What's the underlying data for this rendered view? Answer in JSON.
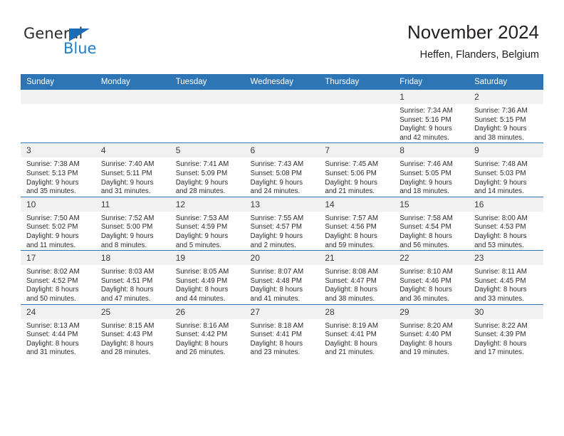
{
  "logo": {
    "word1": "General",
    "word2": "Blue",
    "triangle_color": "#1b6cb3",
    "blue_color": "#1b7fd1"
  },
  "header": {
    "title": "November 2024",
    "subtitle": "Heffen, Flanders, Belgium"
  },
  "theme": {
    "header_blue": "#2e75b6",
    "daynum_bg": "#f1f1f1",
    "text": "#2b2b2b"
  },
  "weekdays": [
    "Sunday",
    "Monday",
    "Tuesday",
    "Wednesday",
    "Thursday",
    "Friday",
    "Saturday"
  ],
  "weeks": [
    [
      {
        "day": "",
        "blank": true
      },
      {
        "day": "",
        "blank": true
      },
      {
        "day": "",
        "blank": true
      },
      {
        "day": "",
        "blank": true
      },
      {
        "day": "",
        "blank": true
      },
      {
        "day": "1",
        "sunrise": "Sunrise: 7:34 AM",
        "sunset": "Sunset: 5:16 PM",
        "daylight1": "Daylight: 9 hours",
        "daylight2": "and 42 minutes."
      },
      {
        "day": "2",
        "sunrise": "Sunrise: 7:36 AM",
        "sunset": "Sunset: 5:15 PM",
        "daylight1": "Daylight: 9 hours",
        "daylight2": "and 38 minutes."
      }
    ],
    [
      {
        "day": "3",
        "sunrise": "Sunrise: 7:38 AM",
        "sunset": "Sunset: 5:13 PM",
        "daylight1": "Daylight: 9 hours",
        "daylight2": "and 35 minutes."
      },
      {
        "day": "4",
        "sunrise": "Sunrise: 7:40 AM",
        "sunset": "Sunset: 5:11 PM",
        "daylight1": "Daylight: 9 hours",
        "daylight2": "and 31 minutes."
      },
      {
        "day": "5",
        "sunrise": "Sunrise: 7:41 AM",
        "sunset": "Sunset: 5:09 PM",
        "daylight1": "Daylight: 9 hours",
        "daylight2": "and 28 minutes."
      },
      {
        "day": "6",
        "sunrise": "Sunrise: 7:43 AM",
        "sunset": "Sunset: 5:08 PM",
        "daylight1": "Daylight: 9 hours",
        "daylight2": "and 24 minutes."
      },
      {
        "day": "7",
        "sunrise": "Sunrise: 7:45 AM",
        "sunset": "Sunset: 5:06 PM",
        "daylight1": "Daylight: 9 hours",
        "daylight2": "and 21 minutes."
      },
      {
        "day": "8",
        "sunrise": "Sunrise: 7:46 AM",
        "sunset": "Sunset: 5:05 PM",
        "daylight1": "Daylight: 9 hours",
        "daylight2": "and 18 minutes."
      },
      {
        "day": "9",
        "sunrise": "Sunrise: 7:48 AM",
        "sunset": "Sunset: 5:03 PM",
        "daylight1": "Daylight: 9 hours",
        "daylight2": "and 14 minutes."
      }
    ],
    [
      {
        "day": "10",
        "sunrise": "Sunrise: 7:50 AM",
        "sunset": "Sunset: 5:02 PM",
        "daylight1": "Daylight: 9 hours",
        "daylight2": "and 11 minutes."
      },
      {
        "day": "11",
        "sunrise": "Sunrise: 7:52 AM",
        "sunset": "Sunset: 5:00 PM",
        "daylight1": "Daylight: 9 hours",
        "daylight2": "and 8 minutes."
      },
      {
        "day": "12",
        "sunrise": "Sunrise: 7:53 AM",
        "sunset": "Sunset: 4:59 PM",
        "daylight1": "Daylight: 9 hours",
        "daylight2": "and 5 minutes."
      },
      {
        "day": "13",
        "sunrise": "Sunrise: 7:55 AM",
        "sunset": "Sunset: 4:57 PM",
        "daylight1": "Daylight: 9 hours",
        "daylight2": "and 2 minutes."
      },
      {
        "day": "14",
        "sunrise": "Sunrise: 7:57 AM",
        "sunset": "Sunset: 4:56 PM",
        "daylight1": "Daylight: 8 hours",
        "daylight2": "and 59 minutes."
      },
      {
        "day": "15",
        "sunrise": "Sunrise: 7:58 AM",
        "sunset": "Sunset: 4:54 PM",
        "daylight1": "Daylight: 8 hours",
        "daylight2": "and 56 minutes."
      },
      {
        "day": "16",
        "sunrise": "Sunrise: 8:00 AM",
        "sunset": "Sunset: 4:53 PM",
        "daylight1": "Daylight: 8 hours",
        "daylight2": "and 53 minutes."
      }
    ],
    [
      {
        "day": "17",
        "sunrise": "Sunrise: 8:02 AM",
        "sunset": "Sunset: 4:52 PM",
        "daylight1": "Daylight: 8 hours",
        "daylight2": "and 50 minutes."
      },
      {
        "day": "18",
        "sunrise": "Sunrise: 8:03 AM",
        "sunset": "Sunset: 4:51 PM",
        "daylight1": "Daylight: 8 hours",
        "daylight2": "and 47 minutes."
      },
      {
        "day": "19",
        "sunrise": "Sunrise: 8:05 AM",
        "sunset": "Sunset: 4:49 PM",
        "daylight1": "Daylight: 8 hours",
        "daylight2": "and 44 minutes."
      },
      {
        "day": "20",
        "sunrise": "Sunrise: 8:07 AM",
        "sunset": "Sunset: 4:48 PM",
        "daylight1": "Daylight: 8 hours",
        "daylight2": "and 41 minutes."
      },
      {
        "day": "21",
        "sunrise": "Sunrise: 8:08 AM",
        "sunset": "Sunset: 4:47 PM",
        "daylight1": "Daylight: 8 hours",
        "daylight2": "and 38 minutes."
      },
      {
        "day": "22",
        "sunrise": "Sunrise: 8:10 AM",
        "sunset": "Sunset: 4:46 PM",
        "daylight1": "Daylight: 8 hours",
        "daylight2": "and 36 minutes."
      },
      {
        "day": "23",
        "sunrise": "Sunrise: 8:11 AM",
        "sunset": "Sunset: 4:45 PM",
        "daylight1": "Daylight: 8 hours",
        "daylight2": "and 33 minutes."
      }
    ],
    [
      {
        "day": "24",
        "sunrise": "Sunrise: 8:13 AM",
        "sunset": "Sunset: 4:44 PM",
        "daylight1": "Daylight: 8 hours",
        "daylight2": "and 31 minutes."
      },
      {
        "day": "25",
        "sunrise": "Sunrise: 8:15 AM",
        "sunset": "Sunset: 4:43 PM",
        "daylight1": "Daylight: 8 hours",
        "daylight2": "and 28 minutes."
      },
      {
        "day": "26",
        "sunrise": "Sunrise: 8:16 AM",
        "sunset": "Sunset: 4:42 PM",
        "daylight1": "Daylight: 8 hours",
        "daylight2": "and 26 minutes."
      },
      {
        "day": "27",
        "sunrise": "Sunrise: 8:18 AM",
        "sunset": "Sunset: 4:41 PM",
        "daylight1": "Daylight: 8 hours",
        "daylight2": "and 23 minutes."
      },
      {
        "day": "28",
        "sunrise": "Sunrise: 8:19 AM",
        "sunset": "Sunset: 4:41 PM",
        "daylight1": "Daylight: 8 hours",
        "daylight2": "and 21 minutes."
      },
      {
        "day": "29",
        "sunrise": "Sunrise: 8:20 AM",
        "sunset": "Sunset: 4:40 PM",
        "daylight1": "Daylight: 8 hours",
        "daylight2": "and 19 minutes."
      },
      {
        "day": "30",
        "sunrise": "Sunrise: 8:22 AM",
        "sunset": "Sunset: 4:39 PM",
        "daylight1": "Daylight: 8 hours",
        "daylight2": "and 17 minutes."
      }
    ]
  ]
}
